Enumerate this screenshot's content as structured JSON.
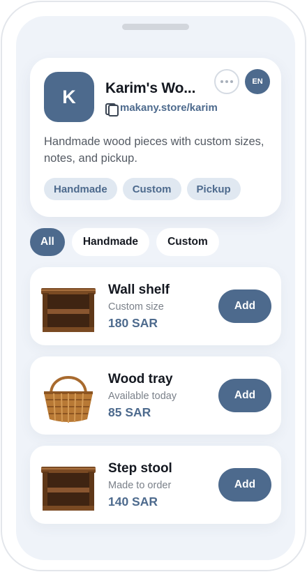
{
  "store": {
    "avatar_letter": "K",
    "name": "Karim's Wo...",
    "link": "makany.store/karim",
    "language": "EN",
    "description": "Handmade wood pieces with custom sizes, notes, and pickup.",
    "tags": [
      "Handmade",
      "Custom",
      "Pickup"
    ]
  },
  "filters": [
    {
      "label": "All",
      "active": true
    },
    {
      "label": "Handmade",
      "active": false
    },
    {
      "label": "Custom",
      "active": false
    }
  ],
  "products": [
    {
      "name": "Wall shelf",
      "subtitle": "Custom size",
      "price": "180 SAR",
      "add_label": "Add",
      "image": "wooden-shelf-image"
    },
    {
      "name": "Wood tray",
      "subtitle": "Available today",
      "price": "85 SAR",
      "add_label": "Add",
      "image": "wicker-basket-image"
    },
    {
      "name": "Step stool",
      "subtitle": "Made to order",
      "price": "140 SAR",
      "add_label": "Add",
      "image": "wooden-shelf-image"
    }
  ],
  "colors": {
    "accent": "#4d6a8d",
    "background": "#eff3f9",
    "tag_background": "#e0e8f1"
  }
}
